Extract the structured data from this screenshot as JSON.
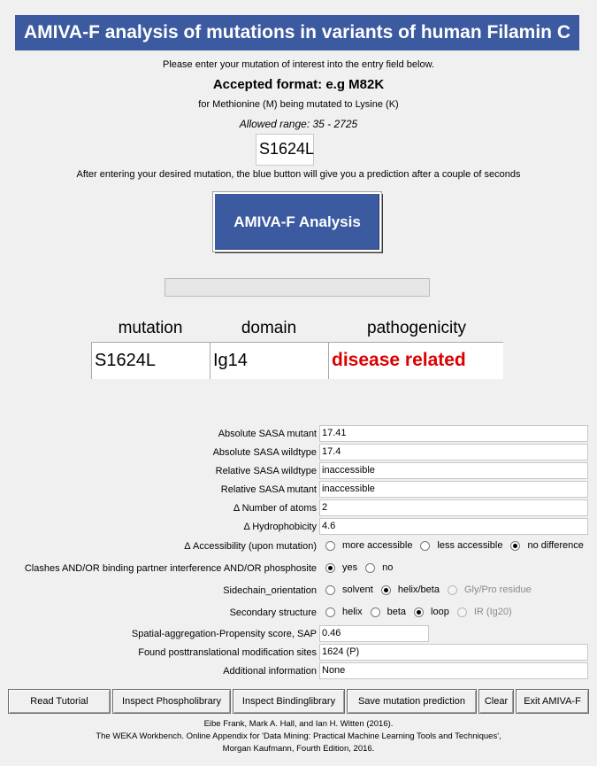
{
  "header": {
    "title": "AMIVA-F analysis of mutations in variants of human Filamin C"
  },
  "instructions": {
    "line1": "Please enter your mutation of interest into the entry field below.",
    "format": "Accepted format: e.g M82K",
    "example": "for Methionine (M) being mutated to Lysine (K)",
    "range": "Allowed range: 35 - 2725",
    "after": "After entering your desired mutation, the blue button will give you a prediction after a couple of seconds"
  },
  "mutation_input": {
    "value": "S1624L"
  },
  "analysis_button": {
    "label": "AMIVA-F Analysis"
  },
  "progress": {
    "fraction": 0
  },
  "results": {
    "headers": [
      "mutation",
      "domain",
      "pathogenicity"
    ],
    "mutation": "S1624L",
    "domain": "Ig14",
    "pathogenicity": "disease related",
    "pathogenicity_color": "#dd0000"
  },
  "properties": [
    {
      "label": "Absolute SASA mutant",
      "value": "17.41"
    },
    {
      "label": "Absolute SASA wildtype",
      "value": "17.4"
    },
    {
      "label": "Relative SASA wildtype",
      "value": "inaccessible"
    },
    {
      "label": "Relative SASA mutant",
      "value": "inaccessible"
    },
    {
      "label": "Δ Number of atoms",
      "value": "2"
    },
    {
      "label": "Δ Hydrophobicity",
      "value": "4.6"
    }
  ],
  "radio_groups": [
    {
      "label": "Δ Accessibility (upon mutation)",
      "options": [
        "more accessible",
        "less accessible",
        "no difference"
      ],
      "selected": "no difference"
    },
    {
      "label": "Clashes AND/OR binding partner interference AND/OR phosphosite",
      "options": [
        "yes",
        "no"
      ],
      "selected": "yes"
    },
    {
      "label": "Sidechain_orientation",
      "options": [
        "solvent",
        "helix/beta",
        "Gly/Pro residue"
      ],
      "selected": "helix/beta"
    },
    {
      "label": "Secondary structure",
      "options": [
        "helix",
        "beta",
        "loop",
        "IR (Ig20)"
      ],
      "selected": "loop"
    }
  ],
  "sap": {
    "label": "Spatial-aggregation-Propensity score, SAP",
    "value": "0.46"
  },
  "ptm": {
    "label": "Found posttranslational modification sites",
    "value": "1624 (P)"
  },
  "additional": {
    "label": "Additional information",
    "value": "None"
  },
  "buttons": {
    "read_tutorial": "Read Tutorial",
    "inspect_phospholibrary": "Inspect Phospholibrary",
    "inspect_bindinglibrary": "Inspect Bindinglibrary",
    "save_prediction": "Save mutation prediction",
    "clear": "Clear",
    "exit": "Exit AMIVA-F"
  },
  "credits": {
    "line1": "Eibe Frank, Mark A. Hall, and Ian H. Witten (2016).",
    "line2": "The WEKA Workbench. Online Appendix for 'Data Mining: Practical Machine Learning Tools and Techniques',",
    "line3": "Morgan Kaufmann, Fourth Edition, 2016."
  },
  "colors": {
    "accent": "#3c5aa0",
    "background": "#f0f0f0"
  }
}
